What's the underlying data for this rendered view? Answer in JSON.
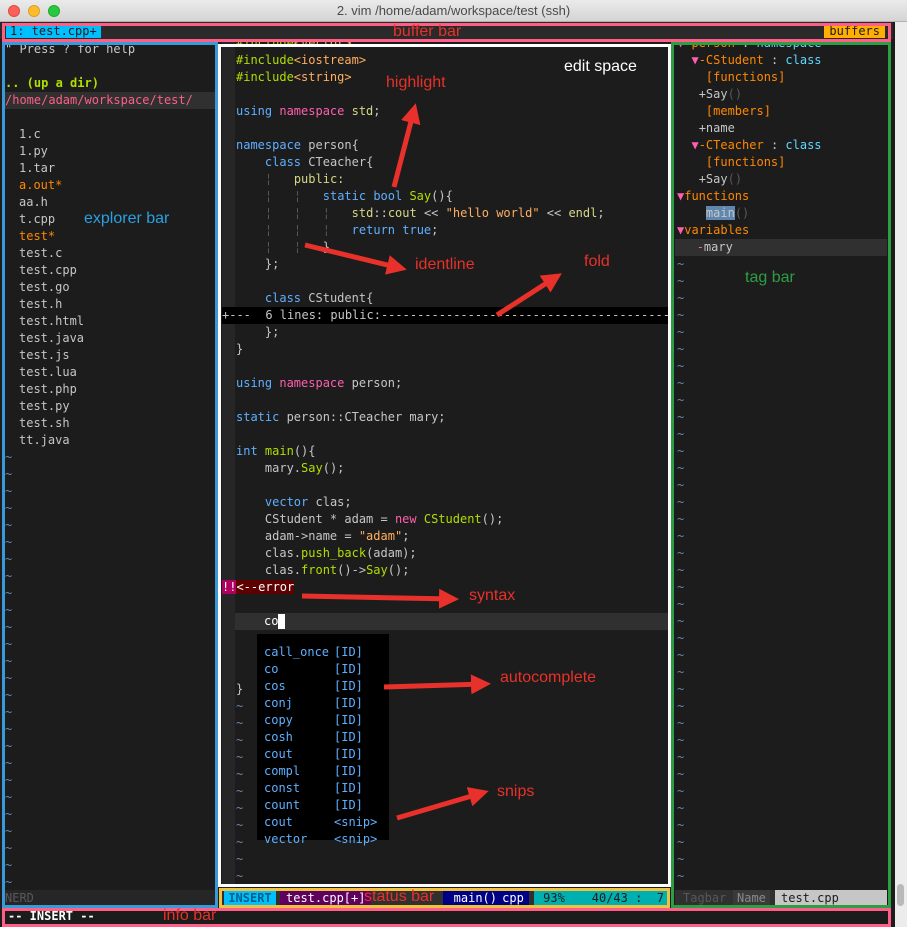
{
  "window": {
    "title": "2. vim  /home/adam/workspace/test (ssh)"
  },
  "buffer_bar": {
    "current": "1: test.cpp+",
    "buffers_button": "buffers"
  },
  "explorer": {
    "help": "\" Press ? for help",
    "updir": ".. (up a dir)",
    "path": "/home/adam/workspace/test/",
    "files": [
      {
        "name": "1.c",
        "color": "#c6c6c6"
      },
      {
        "name": "1.py",
        "color": "#c6c6c6"
      },
      {
        "name": "1.tar",
        "color": "#c6c6c6"
      },
      {
        "name": "a.out*",
        "color": "#ff8700"
      },
      {
        "name": "aa.h",
        "color": "#c6c6c6"
      },
      {
        "name": "t.cpp",
        "color": "#c6c6c6"
      },
      {
        "name": "test*",
        "color": "#ff8700"
      },
      {
        "name": "test.c",
        "color": "#c6c6c6"
      },
      {
        "name": "test.cpp",
        "color": "#c6c6c6"
      },
      {
        "name": "test.go",
        "color": "#c6c6c6"
      },
      {
        "name": "test.h",
        "color": "#c6c6c6"
      },
      {
        "name": "test.html",
        "color": "#c6c6c6"
      },
      {
        "name": "test.java",
        "color": "#c6c6c6"
      },
      {
        "name": "test.js",
        "color": "#c6c6c6"
      },
      {
        "name": "test.lua",
        "color": "#c6c6c6"
      },
      {
        "name": "test.php",
        "color": "#c6c6c6"
      },
      {
        "name": "test.py",
        "color": "#c6c6c6"
      },
      {
        "name": "test.sh",
        "color": "#c6c6c6"
      },
      {
        "name": "tt.java",
        "color": "#c6c6c6"
      }
    ],
    "status": "NERD"
  },
  "editor": {
    "fold_line": "+---  6 lines: public:-------------------------------------------------",
    "cursor_line_text": "co",
    "error_marker": "!!",
    "error_text": "<--error",
    "status": {
      "mode": "INSERT",
      "file": "test.cpp[+]",
      "func": "main()",
      "ft": "cpp",
      "pct": "93%",
      "pos": "40/43 :  7"
    },
    "completions": [
      {
        "word": "call_once",
        "kind": "[ID]"
      },
      {
        "word": "co",
        "kind": "[ID]"
      },
      {
        "word": "cos",
        "kind": "[ID]"
      },
      {
        "word": "conj",
        "kind": "[ID]"
      },
      {
        "word": "copy",
        "kind": "[ID]"
      },
      {
        "word": "cosh",
        "kind": "[ID]"
      },
      {
        "word": "cout",
        "kind": "[ID]"
      },
      {
        "word": "compl",
        "kind": "[ID]"
      },
      {
        "word": "const",
        "kind": "[ID]"
      },
      {
        "word": "count",
        "kind": "[ID]"
      },
      {
        "word": "cout",
        "kind": "<snip>"
      },
      {
        "word": "vector",
        "kind": "<snip>"
      }
    ]
  },
  "tagbar": {
    "status": {
      "name_label": "Tagbar",
      "name_tab": "Name",
      "file": "test.cpp"
    }
  },
  "info_bar": {
    "mode_text": "-- INSERT --"
  },
  "annotations": {
    "buffer_bar": "buffer bar",
    "edit_space": "edit space",
    "highlight": "highlight",
    "explorer_bar": "explorer bar",
    "identline": "identline",
    "fold": "fold",
    "tag_bar": "tag bar",
    "syntax": "syntax",
    "autocomplete": "autocomplete",
    "snips": "snips",
    "status_bar": "status bar",
    "info_bar": "info bar"
  },
  "colors": {
    "buffer_bar_frame": "#ff5f87",
    "explorer_frame": "#3a9ad9",
    "edit_frame": "#ffffff",
    "tag_frame": "#2e9e44",
    "status_frame": "#f0c040",
    "info_frame": "#ff5f87",
    "annotation": "#e8312a"
  }
}
